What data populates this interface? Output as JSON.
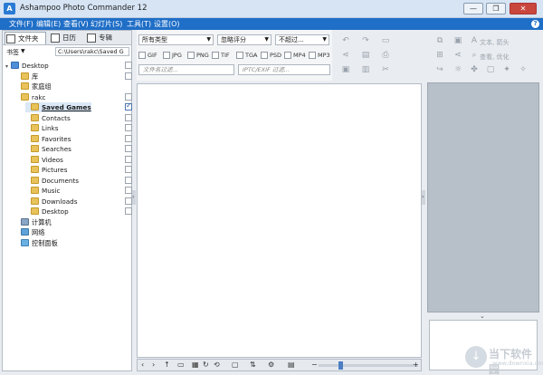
{
  "window": {
    "title": "Ashampoo Photo Commander 12",
    "minimize": "—",
    "restore": "❐",
    "close": "✕"
  },
  "menu": {
    "items": [
      "文件(F)",
      "编辑(E)",
      "查看(V)",
      "幻灯片(S)",
      "工具(T)",
      "设置(O)"
    ],
    "help": "?"
  },
  "left_tabs": [
    {
      "label": "文件夹"
    },
    {
      "label": "日历"
    },
    {
      "label": "专辑"
    }
  ],
  "bookmark": {
    "label": "书签",
    "arrow": "▼",
    "path": "C:\\Users\\rakc\\Saved G"
  },
  "tree": [
    {
      "label": "Desktop",
      "icon": "desktop-icon",
      "level": 0,
      "expand": "▾"
    },
    {
      "label": "库",
      "icon": "folder-icon",
      "level": 1,
      "expand": ""
    },
    {
      "label": "家庭组",
      "icon": "folder-icon",
      "level": 1,
      "expand": ""
    },
    {
      "label": "rakc",
      "icon": "folder-icon",
      "level": 1,
      "expand": ""
    },
    {
      "label": "Saved Games",
      "icon": "folder-icon",
      "level": 2,
      "expand": "",
      "selected": true,
      "checked": true
    },
    {
      "label": "Contacts",
      "icon": "folder-icon",
      "level": 2,
      "expand": ""
    },
    {
      "label": "Links",
      "icon": "folder-icon",
      "level": 2,
      "expand": ""
    },
    {
      "label": "Favorites",
      "icon": "folder-icon",
      "level": 2,
      "expand": ""
    },
    {
      "label": "Searches",
      "icon": "folder-icon",
      "level": 2,
      "expand": ""
    },
    {
      "label": "Videos",
      "icon": "folder-icon",
      "level": 2,
      "expand": ""
    },
    {
      "label": "Pictures",
      "icon": "folder-icon",
      "level": 2,
      "expand": ""
    },
    {
      "label": "Documents",
      "icon": "folder-icon",
      "level": 2,
      "expand": ""
    },
    {
      "label": "Music",
      "icon": "folder-icon",
      "level": 2,
      "expand": ""
    },
    {
      "label": "Downloads",
      "icon": "folder-icon",
      "level": 2,
      "expand": ""
    },
    {
      "label": "Desktop",
      "icon": "folder-icon",
      "level": 2,
      "expand": ""
    },
    {
      "label": "计算机",
      "icon": "computer-icon",
      "level": 1,
      "expand": ""
    },
    {
      "label": "网络",
      "icon": "network-icon",
      "level": 1,
      "expand": ""
    },
    {
      "label": "控制面板",
      "icon": "control-panel-icon",
      "level": 1,
      "expand": ""
    }
  ],
  "filters": {
    "type_select": "所有类型",
    "rating_select": "忽略评分",
    "date_select": "不超过...",
    "file_types": [
      "GIF",
      "JPG",
      "PNG",
      "TIF",
      "TGA",
      "PSD",
      "MP4",
      "MP3"
    ],
    "filename_placeholder": "文件名过滤...",
    "iptc_placeholder": "IPTC/EXIF 过滤..."
  },
  "right_toolbar": {
    "text_label": "文本, 箭头",
    "adjust_label": "查看, 优化"
  },
  "splitters": {
    "left": "‹",
    "right": "›",
    "preview_toggle": "⌄"
  },
  "bottom_toolbar": {
    "back": "‹",
    "forward": "›",
    "up": "↑",
    "zoom_out": "−",
    "zoom_in": "+"
  },
  "watermark": {
    "title": "当下软件园",
    "url": "www.downxia.com"
  },
  "colors": {
    "menubar": "#1f6ec7",
    "title": "#d6e4f4",
    "preview": "#b7bfc9"
  }
}
